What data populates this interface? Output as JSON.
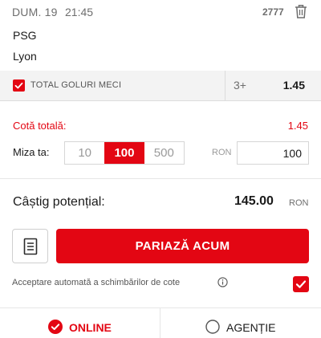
{
  "colors": {
    "accent": "#e30613",
    "muted": "#6e6e6e",
    "panel": "#f3f3f3"
  },
  "match": {
    "date": "DUM. 19",
    "time": "21:45",
    "code": "2777",
    "home_team": "PSG",
    "away_team": "Lyon",
    "delete_icon": "trash-icon"
  },
  "selection": {
    "checked": true,
    "market": "TOTAL GOLURI MECI",
    "outcome": "3+",
    "odds": "1.45"
  },
  "total_odds": {
    "label": "Cotă totală:",
    "value": "1.45"
  },
  "stake": {
    "label": "Miza ta:",
    "presets": [
      "10",
      "100",
      "500"
    ],
    "selected_preset": "100",
    "currency": "RON",
    "value": "100"
  },
  "potential_win": {
    "label": "Câștig potențial:",
    "value": "145.00",
    "currency": "RON"
  },
  "actions": {
    "betslip_icon": "document-icon",
    "bet_label": "PARIAZĂ ACUM"
  },
  "auto_accept": {
    "label": "Acceptare automată a schimbărilor de cote",
    "info_icon": "info-icon",
    "checked": true
  },
  "mode_tabs": [
    {
      "label": "ONLINE",
      "selected": true,
      "icon": "check-circle-icon"
    },
    {
      "label": "AGENȚIE",
      "selected": false,
      "icon": "radio-circle-icon"
    }
  ]
}
